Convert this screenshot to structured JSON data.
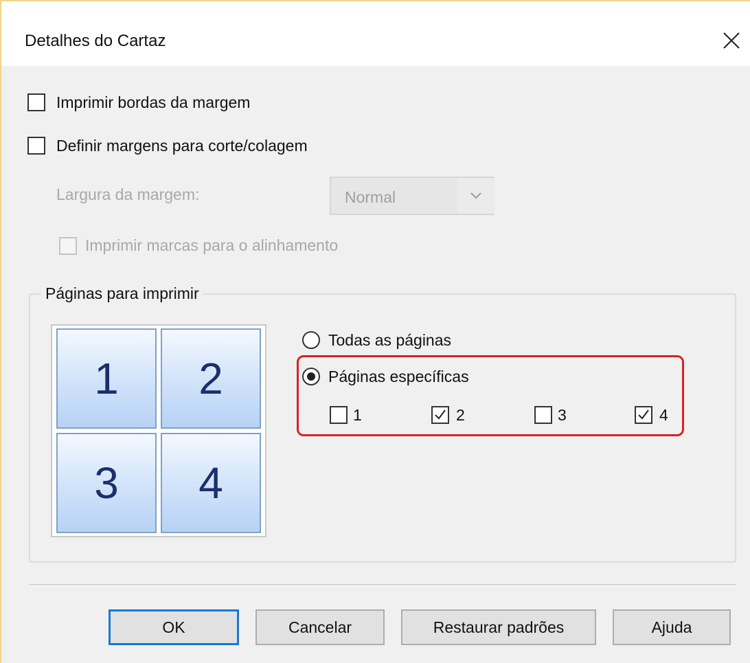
{
  "dialog": {
    "title": "Detalhes do Cartaz",
    "close_icon": "close-icon"
  },
  "options": {
    "print_border": {
      "label": "Imprimir bordas da margem",
      "checked": false
    },
    "set_margins": {
      "label": "Definir margens para corte/colagem",
      "checked": false
    },
    "margin_width": {
      "label": "Largura da margem:",
      "value": "Normal",
      "enabled": false
    },
    "alignment_marks": {
      "label": "Imprimir marcas para o alinhamento",
      "checked": false,
      "enabled": false
    }
  },
  "pages_group": {
    "legend": "Páginas para imprimir",
    "preview_tiles": [
      "1",
      "2",
      "3",
      "4"
    ],
    "all_pages_label": "Todas as páginas",
    "specific_pages_label": "Páginas específicas",
    "selected_mode": "specific",
    "pages": [
      {
        "label": "1",
        "checked": false
      },
      {
        "label": "2",
        "checked": true
      },
      {
        "label": "3",
        "checked": false
      },
      {
        "label": "4",
        "checked": true
      }
    ]
  },
  "buttons": {
    "ok": "OK",
    "cancel": "Cancelar",
    "restore": "Restaurar padrões",
    "help": "Ajuda"
  },
  "colors": {
    "highlight": "#d42424",
    "default_button_border": "#1479d7",
    "tile_text": "#1a2f6b"
  }
}
